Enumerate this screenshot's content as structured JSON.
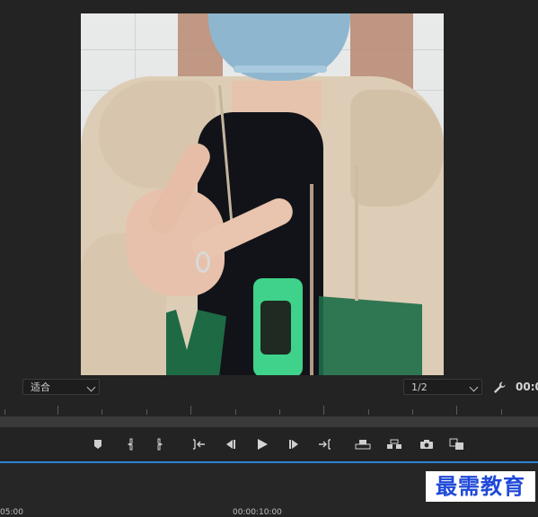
{
  "monitor": {
    "preview_alt": "program monitor video frame"
  },
  "controls": {
    "fit_select": "适合",
    "resolution_select": "1/2",
    "timecode_right": "00:0"
  },
  "transport": {
    "icons": [
      "add-marker-icon",
      "mark-in-icon",
      "mark-out-icon",
      "go-to-in-icon",
      "step-back-icon",
      "play-icon",
      "step-forward-icon",
      "go-to-out-icon",
      "lift-icon",
      "extract-icon",
      "export-frame-icon",
      "compare-icon"
    ]
  },
  "timeline": {
    "left_label": "05:00",
    "mid_label": "00:00:10:00"
  },
  "watermark": {
    "text": "最需教育"
  },
  "colors": {
    "accent": "#2c84d8",
    "watermark_text": "#1f49d8",
    "panel_bg": "#232323"
  }
}
